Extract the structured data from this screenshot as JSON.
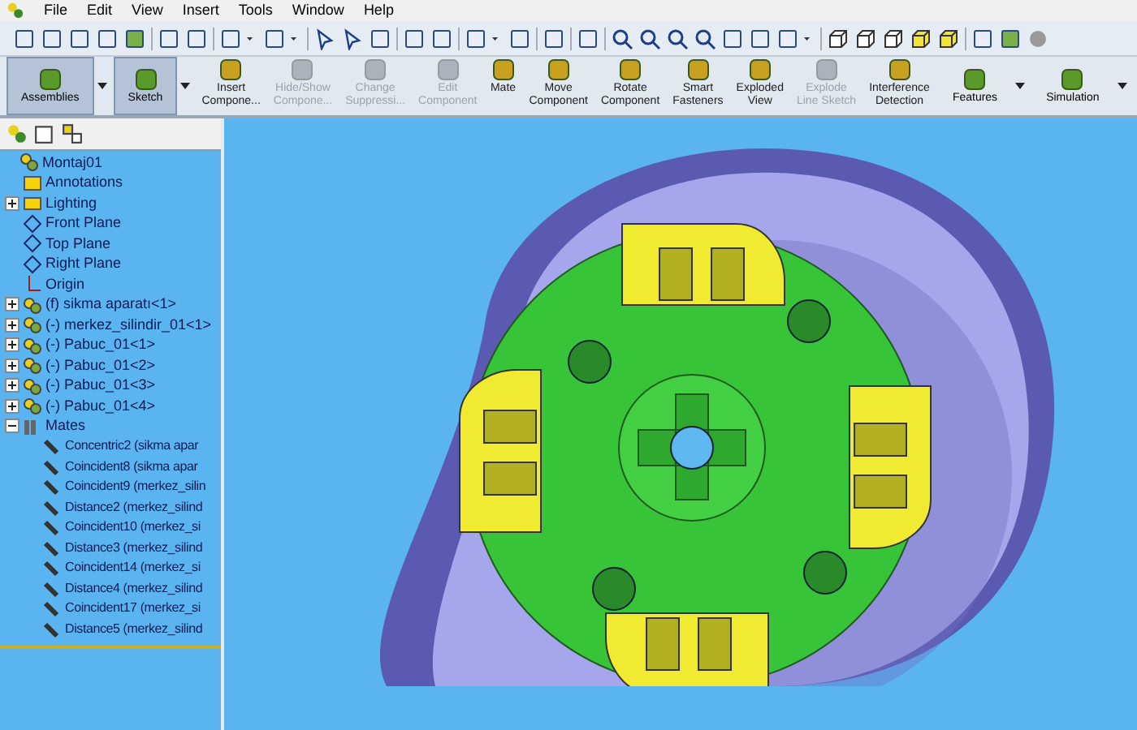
{
  "menu_bar": [
    "File",
    "Edit",
    "View",
    "Insert",
    "Tools",
    "Window",
    "Help"
  ],
  "command_manager": [
    {
      "kind": "tab",
      "lines": [
        "Assemblies"
      ],
      "selected": true
    },
    {
      "kind": "tab",
      "lines": [
        "Sketch"
      ],
      "selected": true
    },
    {
      "kind": "command",
      "lines": [
        "Insert",
        "Compone..."
      ],
      "disabled": false
    },
    {
      "kind": "command",
      "lines": [
        "Hide/Show",
        "Compone..."
      ],
      "disabled": true
    },
    {
      "kind": "command",
      "lines": [
        "Change",
        "Suppressi..."
      ],
      "disabled": true
    },
    {
      "kind": "command",
      "lines": [
        "Edit",
        "Component"
      ],
      "disabled": true
    },
    {
      "kind": "command",
      "lines": [
        "Mate"
      ],
      "disabled": false
    },
    {
      "kind": "command",
      "lines": [
        "Move",
        "Component"
      ],
      "disabled": false
    },
    {
      "kind": "command",
      "lines": [
        "Rotate",
        "Component"
      ],
      "disabled": false
    },
    {
      "kind": "command",
      "lines": [
        "Smart",
        "Fasteners"
      ],
      "disabled": false
    },
    {
      "kind": "command",
      "lines": [
        "Exploded",
        "View"
      ],
      "disabled": false
    },
    {
      "kind": "command",
      "lines": [
        "Explode",
        "Line Sketch"
      ],
      "disabled": true
    },
    {
      "kind": "command",
      "lines": [
        "Interference",
        "Detection"
      ],
      "disabled": false
    },
    {
      "kind": "tab",
      "lines": [
        "Features"
      ],
      "selected": false
    },
    {
      "kind": "tab",
      "lines": [
        "Simulation"
      ],
      "selected": false
    }
  ],
  "feature_tree": {
    "root": {
      "label": "Montaj01",
      "children": [
        {
          "label": "Annotations",
          "kind": "annotations"
        },
        {
          "label": "Lighting",
          "kind": "lighting",
          "expanded": false
        },
        {
          "label": "Front Plane",
          "kind": "plane"
        },
        {
          "label": "Top Plane",
          "kind": "plane"
        },
        {
          "label": "Right Plane",
          "kind": "plane"
        },
        {
          "label": "Origin",
          "kind": "origin"
        },
        {
          "label": "(f) sikma aparatı<1>",
          "kind": "part",
          "expanded": false
        },
        {
          "label": "(-) merkez_silindir_01<1>",
          "kind": "part",
          "expanded": false
        },
        {
          "label": "(-) Pabuc_01<1>",
          "kind": "part",
          "expanded": false
        },
        {
          "label": "(-) Pabuc_01<2>",
          "kind": "part",
          "expanded": false
        },
        {
          "label": "(-) Pabuc_01<3>",
          "kind": "part",
          "expanded": false
        },
        {
          "label": "(-) Pabuc_01<4>",
          "kind": "part",
          "expanded": false
        },
        {
          "label": "Mates",
          "kind": "mates",
          "expanded": true,
          "children": [
            {
              "label": "Concentric2 (sikma apar",
              "kind": "mate"
            },
            {
              "label": "Coincident8 (sikma apar",
              "kind": "mate"
            },
            {
              "label": "Coincident9 (merkez_silin",
              "kind": "mate"
            },
            {
              "label": "Distance2 (merkez_silind",
              "kind": "mate"
            },
            {
              "label": "Coincident10 (merkez_si",
              "kind": "mate"
            },
            {
              "label": "Distance3 (merkez_silind",
              "kind": "mate"
            },
            {
              "label": "Coincident14 (merkez_si",
              "kind": "mate"
            },
            {
              "label": "Distance4 (merkez_silind",
              "kind": "mate"
            },
            {
              "label": "Coincident17 (merkez_si",
              "kind": "mate"
            },
            {
              "label": "Distance5 (merkez_silind",
              "kind": "mate"
            }
          ]
        }
      ]
    }
  }
}
